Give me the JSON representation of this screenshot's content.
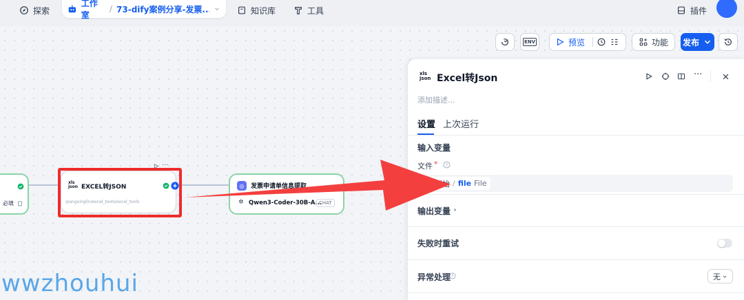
{
  "nav": {
    "explore": "探索",
    "workspace": "工作室",
    "separator": "/",
    "app_name": "73-dify案例分享-发票...",
    "knowledge": "知识库",
    "tools": "工具",
    "plugins": "插件"
  },
  "toolbar": {
    "env": "ENV",
    "preview": "预览",
    "features": "功能",
    "publish": "发布"
  },
  "nodes": {
    "left_badge": "必填",
    "excel_title": "EXCEL转JSON",
    "excel_subtitle": "qiangxinglin/excel_tools/excel_tools",
    "gen_title": "发票申请单信息提取",
    "gen_model": "Qwen3-Coder-30B-A...",
    "gen_model_tag": "CHAT"
  },
  "panel": {
    "title": "Excel转Json",
    "description_placeholder": "添加描述...",
    "tab_settings": "设置",
    "tab_last_run": "上次运行",
    "input_vars": "输入变量",
    "file_label": "文件",
    "required_mark": "*",
    "var_node": "开始",
    "var_sep": "/",
    "var_name": "file",
    "var_type": "File",
    "output_vars": "输出变量",
    "retry_on_failure": "失败时重试",
    "exception_handling": "异常处理",
    "exception_value": "无"
  },
  "watermark": "wwzhouhui",
  "colors": {
    "accent": "#155eef",
    "success": "#12b76a",
    "highlight": "#ef2b2b",
    "arrow": "#f43f3f"
  }
}
